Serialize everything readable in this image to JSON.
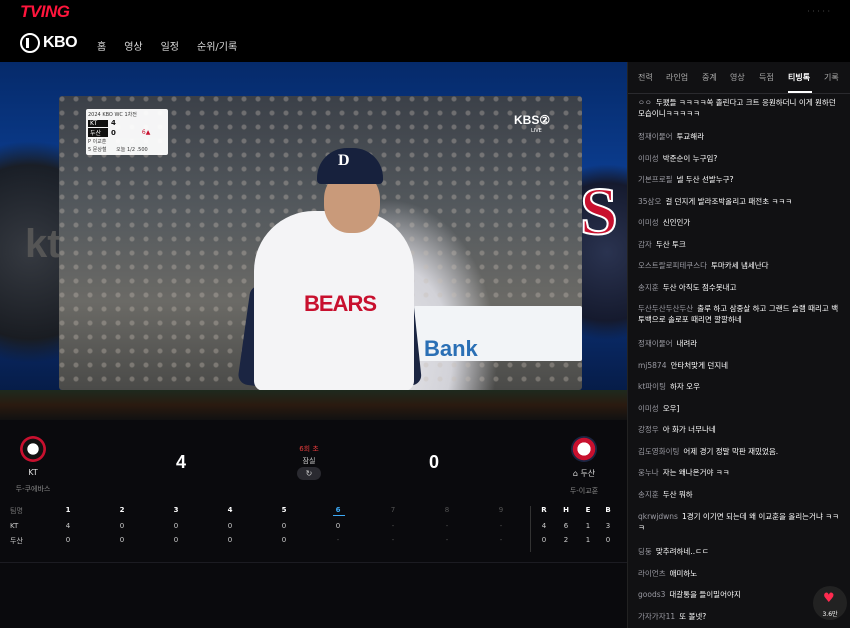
{
  "app": {
    "logo": "TVING",
    "top_right": "· · ·  ·  ·"
  },
  "nav": {
    "brand": "KBO",
    "items": [
      "홈",
      "영상",
      "일정",
      "순위/기록"
    ]
  },
  "video": {
    "scorebug": {
      "title": "2024 KBO WC 1차전",
      "teams": [
        {
          "name": "KT",
          "score": "4"
        },
        {
          "name": "두산",
          "score": "0"
        }
      ],
      "pitcher": "P 이교훈",
      "batter": "5 문상철",
      "count": "오늘 1/2  .500",
      "inning": "6▲"
    },
    "broadcaster": "KBS②",
    "live": "LIVE",
    "jersey": "BEARS",
    "cap": "D",
    "banner": "Bank",
    "left_logo": "kt",
    "right_logo": "S"
  },
  "game": {
    "home": {
      "name": "KT",
      "pitcher": "두-쿠에바스",
      "score": "4"
    },
    "away": {
      "name": "⌂ 두산",
      "pitcher": "두-이교훈",
      "score": "0"
    },
    "inning": "6회 초",
    "stadium": "잠실",
    "refresh_icon": "↻"
  },
  "linescore": {
    "header_label": "팀명",
    "innings": [
      "1",
      "2",
      "3",
      "4",
      "5",
      "6",
      "7",
      "8",
      "9"
    ],
    "totals_labels": [
      "R",
      "H",
      "E",
      "B"
    ],
    "rows": [
      {
        "team": "KT",
        "innings": [
          "4",
          "0",
          "0",
          "0",
          "0",
          "0",
          "-",
          "-",
          "-"
        ],
        "totals": [
          "4",
          "6",
          "1",
          "3"
        ]
      },
      {
        "team": "두산",
        "innings": [
          "0",
          "0",
          "0",
          "0",
          "0",
          "-",
          "-",
          "-",
          "-"
        ],
        "totals": [
          "0",
          "2",
          "1",
          "0"
        ]
      }
    ],
    "active_inning": "6"
  },
  "side_panel": {
    "tabs": [
      "전력",
      "라인업",
      "중계",
      "영상",
      "득점",
      "티빙톡",
      "기록"
    ],
    "active_tab": "티빙톡",
    "messages": [
      {
        "user": "ㅇㅇ",
        "text": "두팼들 ㅋㅋㅋㅋ쏙 졸린다고 크트 응원하더니 이게 원하던 모습이니ㅋㅋㅋㅋㅋ"
      },
      {
        "user": "정재이물어",
        "text": "투교해라"
      },
      {
        "user": "이미성",
        "text": "박준순이 누구임?"
      },
      {
        "user": "기본프로필",
        "text": "넬 두산 선발누구?"
      },
      {
        "user": "35삼오",
        "text": "걸 던지게 발라조박올리고 패전초 ㅋㅋㅋ"
      },
      {
        "user": "이미성",
        "text": "신인인가"
      },
      {
        "user": "감자",
        "text": "두산 투크"
      },
      {
        "user": "오스트랄로피테쿠스다",
        "text": "투마카세 냄세난다"
      },
      {
        "user": "송지훈",
        "text": "두산 아직도 점수못내고"
      },
      {
        "user": "두산두산두산두산",
        "text": "출루 하고 삼중살 하고 그랜드 슬램 때리고 백투백으로 솔로포 때리면 깔깔하네"
      },
      {
        "user": "정재이물어",
        "text": "내려라"
      },
      {
        "user": "mj5874",
        "text": "안타처맞게 던지네"
      },
      {
        "user": "kt파이팅",
        "text": "하자 오우"
      },
      {
        "user": "이미성",
        "text": "오우]"
      },
      {
        "user": "강정우",
        "text": "아 화가 너무나네"
      },
      {
        "user": "김도영화이팅",
        "text": "어제 경기 정말 막판 재밌었음."
      },
      {
        "user": "웅누나",
        "text": "자는 왜나온거야 ㅋㅋ"
      },
      {
        "user": "송지훈",
        "text": "두산 뭐하"
      },
      {
        "user": "qkrwjdwns",
        "text": "1경기 이기면 되는데 왜 이교훈을 올리는거냐 ㅋㅋㅋ"
      },
      {
        "user": "딩둥",
        "text": "맞추려하네..ㄷㄷ"
      },
      {
        "user": "라이언츠",
        "text": "애미하노"
      },
      {
        "user": "goods3",
        "text": "대갈통을 들이밀어야지"
      },
      {
        "user": "가자가자11",
        "text": "또 볼넷?"
      }
    ],
    "like_count": "3.6만"
  }
}
